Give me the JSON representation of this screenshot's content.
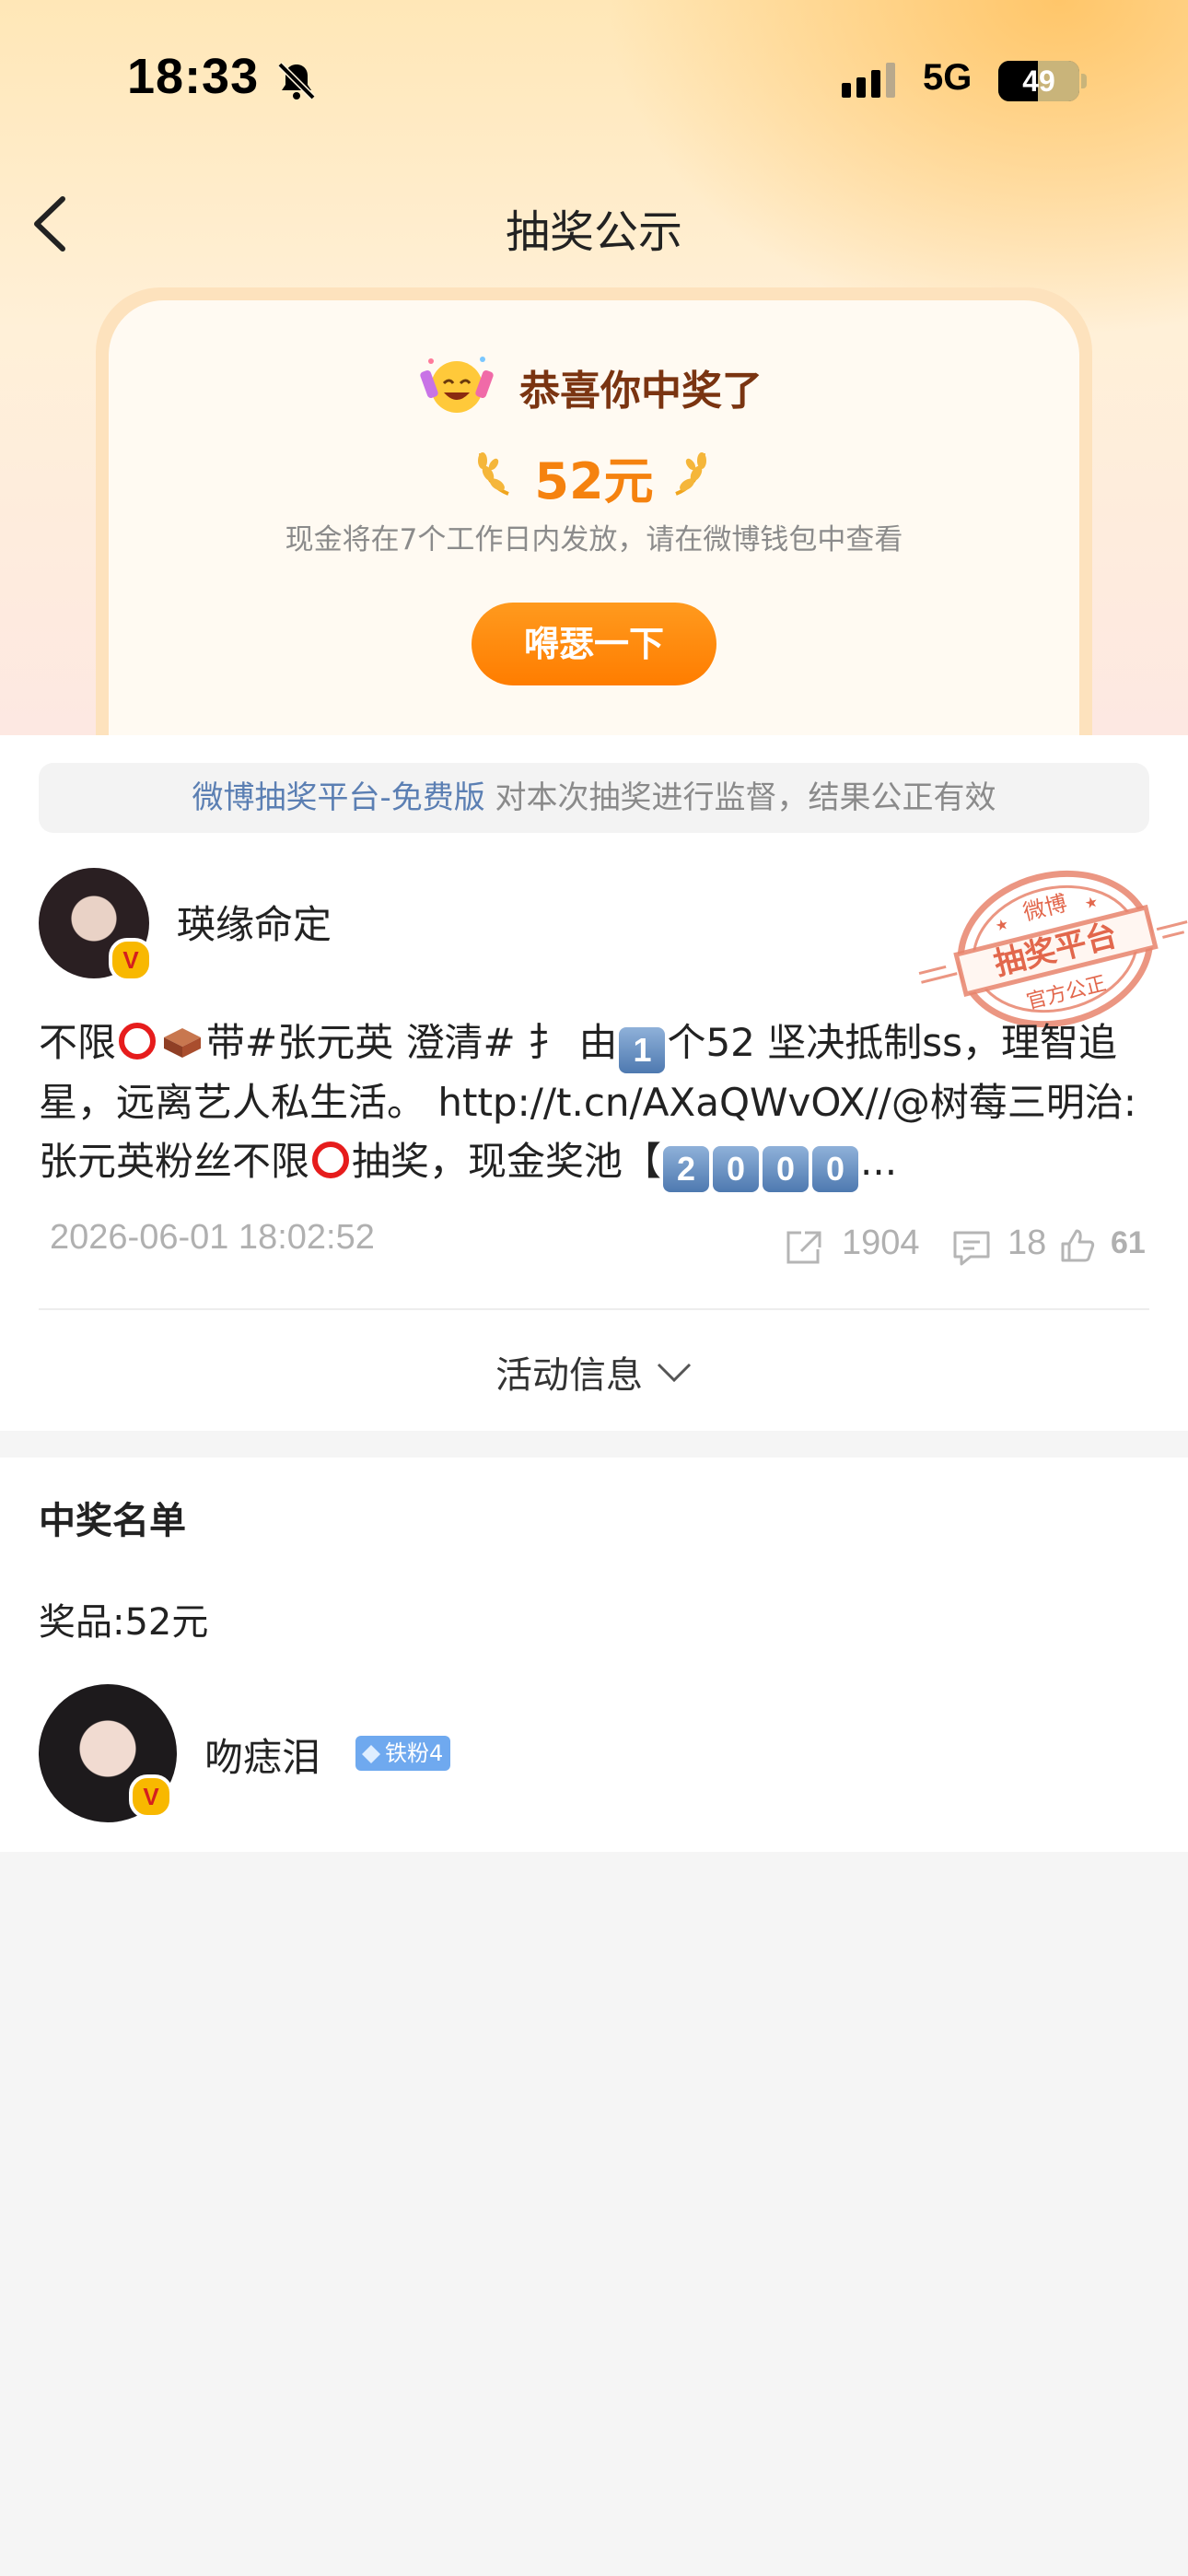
{
  "status_bar": {
    "time": "18:33",
    "network": "5G",
    "battery": "49"
  },
  "header": {
    "title": "抽奖公示"
  },
  "prize_card": {
    "congrats": "恭喜你中奖了",
    "amount": "52元",
    "note": "现金将在7个工作日内发放，请在微博钱包中查看",
    "cta": "嘚瑟一下"
  },
  "notice": {
    "link": "微博抽奖平台-免费版",
    "text": " 对本次抽奖进行监督，结果公正有效"
  },
  "post": {
    "author": "瑛缘命定",
    "stamp": {
      "top": "微博",
      "main": "抽奖平台",
      "bottom": "官方公正"
    },
    "text_1": "不限",
    "text_2": "带#张元英 澄清# 扌 由",
    "key_1": "1",
    "text_3": "个52 坚决抵制ss，理智追星，远离艺人私生活。 http://t.cn/AXaQWvOX//@树莓三明治:张元英粉丝不限",
    "text_4": "抽奖，现金奖池【",
    "keys_2": [
      "2",
      "0",
      "0",
      "0"
    ],
    "text_5": "...",
    "timestamp": "2026-06-01 18:02:52",
    "shares": "1904",
    "comments": "18",
    "likes": "61"
  },
  "activity": {
    "label": "活动信息"
  },
  "winners": {
    "title": "中奖名单",
    "prize": "奖品:52元",
    "winner_name": "吻痣泪",
    "badge": "铁粉4"
  }
}
